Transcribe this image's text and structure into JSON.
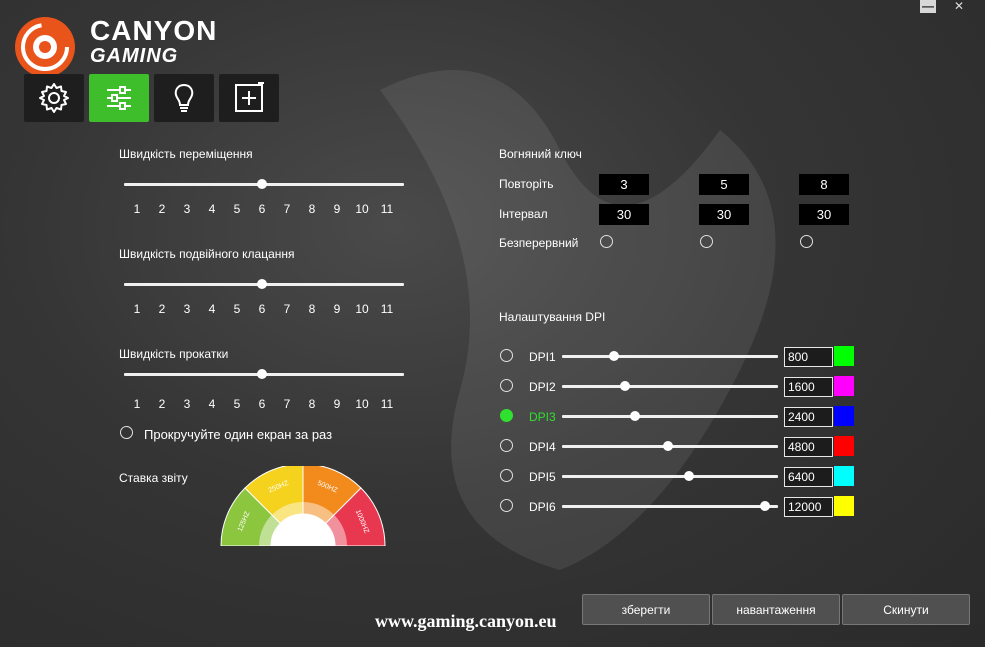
{
  "window": {
    "minimize_label": "—",
    "close_label": "✕"
  },
  "brand": {
    "line1": "CANYON",
    "line2": "GAMING",
    "url": "www.gaming.canyon.eu"
  },
  "tabs": [
    {
      "icon": "gear-icon",
      "active": false
    },
    {
      "icon": "sliders-icon",
      "active": true
    },
    {
      "icon": "lightbulb-icon",
      "active": false
    },
    {
      "icon": "macro-plus-icon",
      "active": false
    }
  ],
  "sliders": {
    "ticks": [
      "1",
      "2",
      "3",
      "4",
      "5",
      "6",
      "7",
      "8",
      "9",
      "10",
      "11"
    ],
    "movement": {
      "label": "Швидкість переміщення",
      "value": 6
    },
    "double_click": {
      "label": "Швидкість подвійного клацання",
      "value": 6
    },
    "scroll": {
      "label": "Швидкість прокатки",
      "value": 6
    }
  },
  "scroll_page": {
    "label": "Прокручуйте один екран за раз",
    "checked": false
  },
  "report_rate": {
    "label": "Ставка звіту",
    "segments": [
      "125HZ",
      "250HZ",
      "500HZ",
      "1000HZ"
    ],
    "colors": [
      "#8cc63f",
      "#f5d21e",
      "#f28a1c",
      "#e8384f"
    ]
  },
  "fire_key": {
    "title": "Вогняний ключ",
    "repeat_label": "Повторіть",
    "interval_label": "Інтервал",
    "continuous_label": "Безперервний",
    "repeat": [
      "3",
      "5",
      "8"
    ],
    "interval": [
      "30",
      "30",
      "30"
    ]
  },
  "dpi": {
    "title": "Налаштування DPI",
    "active_index": 2,
    "max": 12000,
    "items": [
      {
        "label": "DPI1",
        "value": "800",
        "color": "#00ff00"
      },
      {
        "label": "DPI2",
        "value": "1600",
        "color": "#ff00ff"
      },
      {
        "label": "DPI3",
        "value": "2400",
        "color": "#0000ff"
      },
      {
        "label": "DPI4",
        "value": "4800",
        "color": "#ff0000"
      },
      {
        "label": "DPI5",
        "value": "6400",
        "color": "#00ffff"
      },
      {
        "label": "DPI6",
        "value": "12000",
        "color": "#ffff00"
      }
    ]
  },
  "buttons": {
    "save": "зберегти",
    "load": "навантаження",
    "reset": "Скинути"
  }
}
